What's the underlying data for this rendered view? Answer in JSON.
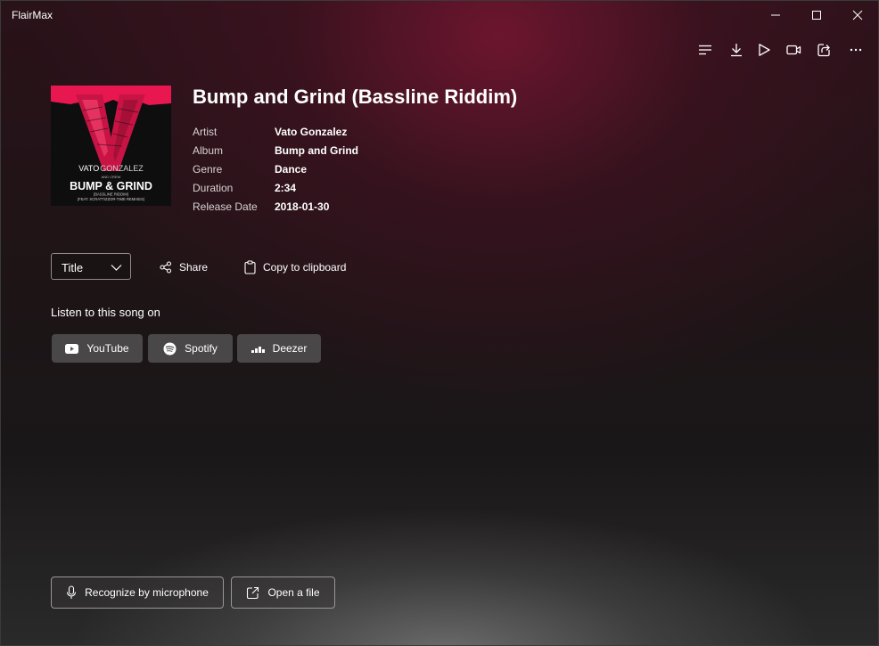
{
  "app": {
    "title": "FlairMax"
  },
  "window_controls": {
    "minimize_icon": "minimize-icon",
    "maximize_icon": "maximize-icon",
    "close_icon": "close-icon"
  },
  "toolbar": {
    "icons": [
      "list-icon",
      "download-icon",
      "play-icon",
      "video-icon",
      "share-external-icon",
      "more-icon"
    ]
  },
  "song": {
    "title": "Bump and Grind (Bassline Riddim)",
    "cover": {
      "artist_text_1": "VATO",
      "artist_text_2": "GONZALEZ",
      "presents": "AND CREW",
      "title_text": "BUMP & GRIND",
      "subtitle_1": "(BASSLINE RIDDIM)",
      "subtitle_2": "(FEAT. SCRATTIZZOR-TIME REMIXES)"
    },
    "metadata": [
      {
        "label": "Artist",
        "value": "Vato Gonzalez"
      },
      {
        "label": "Album",
        "value": "Bump and Grind"
      },
      {
        "label": "Genre",
        "value": "Dance"
      },
      {
        "label": "Duration",
        "value": "2:34"
      },
      {
        "label": "Release Date",
        "value": "2018-01-30"
      }
    ]
  },
  "controls": {
    "select_value": "Title",
    "share_label": "Share",
    "copy_label": "Copy to clipboard"
  },
  "listen": {
    "heading": "Listen to this song on",
    "services": [
      {
        "label": "YouTube",
        "icon": "youtube-icon"
      },
      {
        "label": "Spotify",
        "icon": "spotify-icon"
      },
      {
        "label": "Deezer",
        "icon": "deezer-icon"
      }
    ]
  },
  "bottom": {
    "recognize_label": "Recognize by microphone",
    "open_file_label": "Open a file"
  },
  "colors": {
    "accent_red": "#e8174f",
    "window_bg": "#151314"
  }
}
